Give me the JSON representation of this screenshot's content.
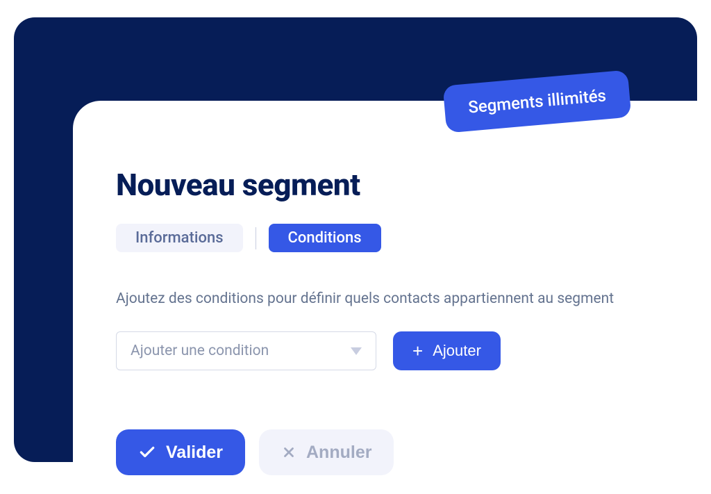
{
  "badge": {
    "label": "Segments illimités"
  },
  "title": "Nouveau segment",
  "tabs": {
    "info": "Informations",
    "conditions": "Conditions"
  },
  "helper": "Ajoutez des conditions pour définir quels contacts appartiennent au segment",
  "select": {
    "placeholder": "Ajouter une condition"
  },
  "buttons": {
    "add": "Ajouter",
    "validate": "Valider",
    "cancel": "Annuler"
  }
}
